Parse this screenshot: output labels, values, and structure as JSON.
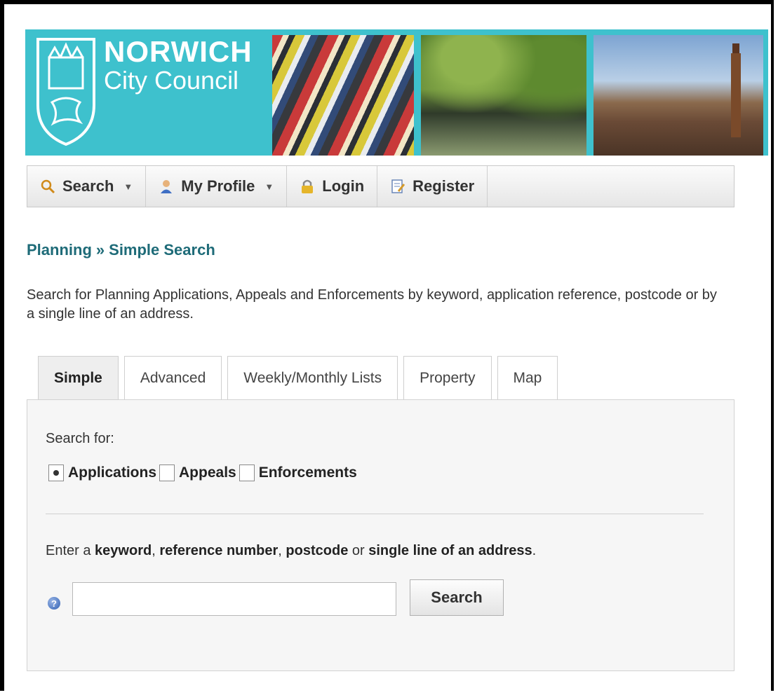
{
  "header": {
    "brand_line1": "NORWICH",
    "brand_line2": "City Council"
  },
  "nav": {
    "items": [
      {
        "label": "Search",
        "icon": "magnifier-icon",
        "dropdown": true
      },
      {
        "label": "My Profile",
        "icon": "user-icon",
        "dropdown": true
      },
      {
        "label": "Login",
        "icon": "padlock-icon",
        "dropdown": false
      },
      {
        "label": "Register",
        "icon": "register-form-icon",
        "dropdown": false
      }
    ]
  },
  "breadcrumb": {
    "parent": "Planning",
    "separator": "»",
    "current": "Simple Search"
  },
  "intro_text": "Search for Planning Applications, Appeals and Enforcements by keyword, application reference, postcode or by a single line of an address.",
  "tabs": [
    {
      "label": "Simple",
      "active": true
    },
    {
      "label": "Advanced",
      "active": false
    },
    {
      "label": "Weekly/Monthly Lists",
      "active": false
    },
    {
      "label": "Property",
      "active": false
    },
    {
      "label": "Map",
      "active": false
    }
  ],
  "search_form": {
    "search_for_label": "Search for:",
    "options": [
      {
        "label": "Applications",
        "checked": true
      },
      {
        "label": "Appeals",
        "checked": false
      },
      {
        "label": "Enforcements",
        "checked": false
      }
    ],
    "instruction": {
      "p1": "Enter a ",
      "b1": "keyword",
      "p2": ", ",
      "b2": "reference number",
      "p3": ", ",
      "b3": "postcode",
      "p4": " or ",
      "b4": "single line of an address",
      "p5": "."
    },
    "input_value": "",
    "button_label": "Search"
  },
  "colors": {
    "banner": "#3ec1cd",
    "breadcrumb": "#1e6b78"
  }
}
